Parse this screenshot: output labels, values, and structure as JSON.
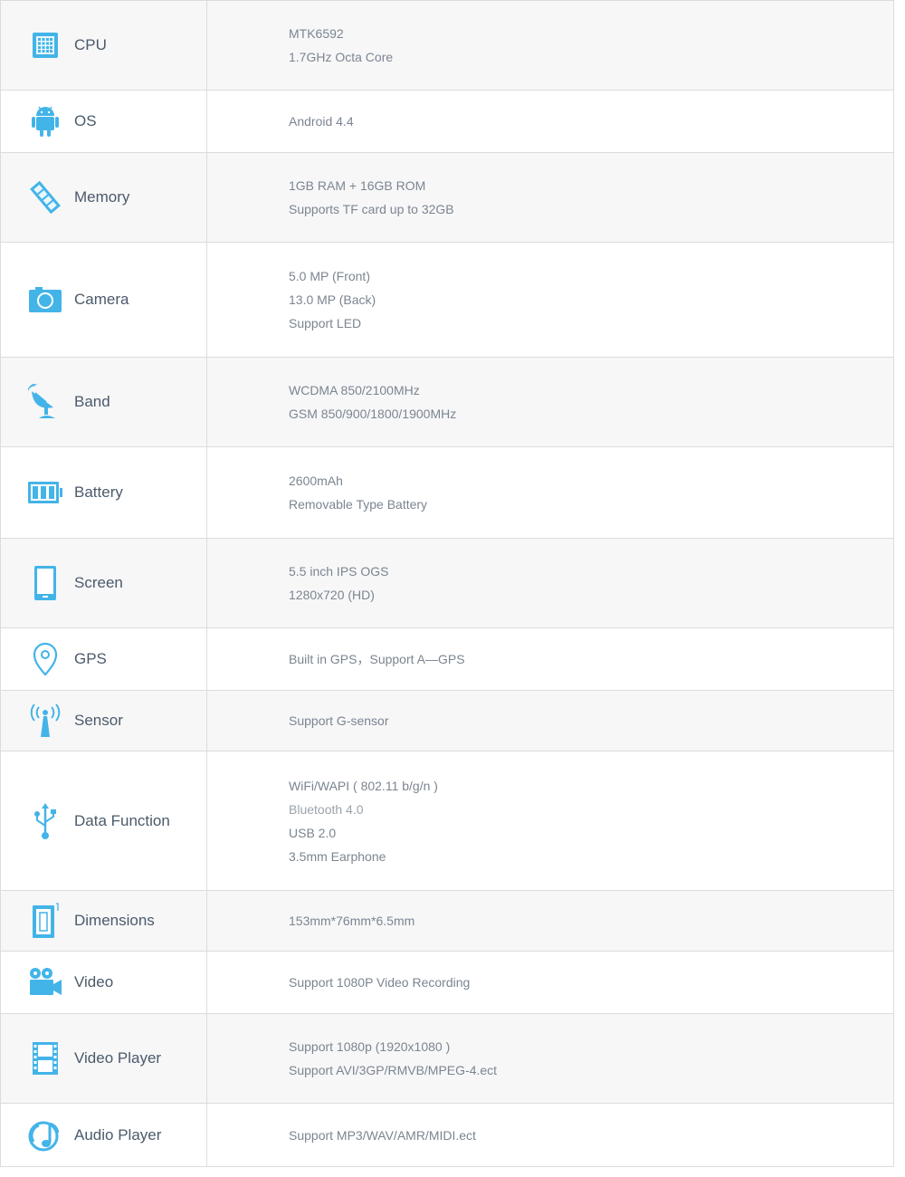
{
  "accent_color": "#43b4e8",
  "specs": [
    {
      "icon": "cpu-icon",
      "label": "CPU",
      "lines": [
        "MTK6592",
        "1.7GHz Octa Core"
      ]
    },
    {
      "icon": "android-icon",
      "label": "OS",
      "lines": [
        "Android 4.4"
      ]
    },
    {
      "icon": "memory-chip-icon",
      "label": "Memory",
      "lines": [
        "1GB RAM + 16GB ROM",
        "Supports TF card up to 32GB"
      ]
    },
    {
      "icon": "camera-icon",
      "label": "Camera",
      "lines": [
        "5.0 MP (Front)",
        "13.0 MP (Back)",
        "Support LED"
      ]
    },
    {
      "icon": "satellite-dish-icon",
      "label": "Band",
      "lines": [
        "WCDMA 850/2100MHz",
        "GSM 850/900/1800/1900MHz"
      ]
    },
    {
      "icon": "battery-icon",
      "label": "Battery",
      "lines": [
        "2600mAh",
        "Removable Type Battery"
      ]
    },
    {
      "icon": "phone-screen-icon",
      "label": "Screen",
      "lines": [
        "5.5 inch IPS OGS",
        "1280x720 (HD)"
      ]
    },
    {
      "icon": "location-pin-icon",
      "label": "GPS",
      "lines": [
        "Built in GPS，Support A—GPS"
      ]
    },
    {
      "icon": "antenna-icon",
      "label": "Sensor",
      "lines": [
        "Support G-sensor"
      ]
    },
    {
      "icon": "usb-icon",
      "label": "Data Function",
      "lines": [
        "WiFi/WAPI ( 802.11 b/g/n )",
        "Bluetooth  4.0",
        "USB 2.0",
        "3.5mm Earphone"
      ]
    },
    {
      "icon": "dimensions-icon",
      "label": "Dimensions",
      "lines": [
        "153mm*76mm*6.5mm"
      ]
    },
    {
      "icon": "video-camera-icon",
      "label": "Video",
      "lines": [
        "Support 1080P Video Recording"
      ]
    },
    {
      "icon": "film-strip-icon",
      "label": "Video Player",
      "lines": [
        "Support 1080p (1920x1080 )",
        "Support AVI/3GP/RMVB/MPEG-4.ect"
      ]
    },
    {
      "icon": "music-note-icon",
      "label": "Audio Player",
      "lines": [
        "Support MP3/WAV/AMR/MIDI.ect"
      ]
    }
  ]
}
